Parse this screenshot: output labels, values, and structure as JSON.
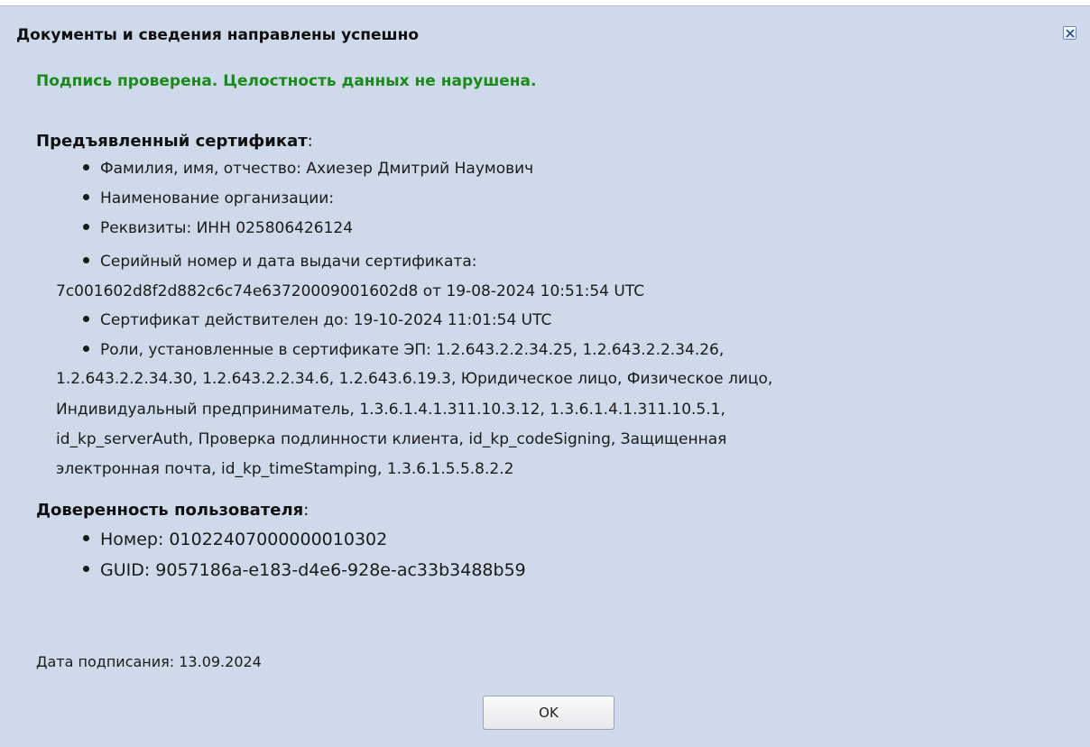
{
  "dialog": {
    "title": "Документы и сведения направлены успешно",
    "close_icon": "close-icon",
    "status": "Подпись проверена. Целостность данных не нарушена.",
    "status_color": "#1a8a1a",
    "background": "#cedae9"
  },
  "certificate": {
    "heading_bold": "Предъявленный сертификат",
    "heading_suffix": ":",
    "items": [
      "Фамилия, имя, отчество: Ахиезер Дмитрий Наумович",
      "Наименование организации:",
      "Реквизиты: ИНН 025806426124",
      "Серийный номер и дата выдачи сертификата:"
    ],
    "serial_line": "7c001602d8f2d882c6c74e63720009001602d8 от 19-08-2024 10:51:54 UTC",
    "valid_until": "Сертификат действителен до: 19-10-2024 11:01:54 UTC",
    "roles_lines": [
      "Роли, установленные в сертификате ЭП: 1.2.643.2.2.34.25, 1.2.643.2.2.34.26,",
      "1.2.643.2.2.34.30, 1.2.643.2.2.34.6, 1.2.643.6.19.3, Юридическое лицо, Физическое лицо,",
      "Индивидуальный предприниматель, 1.3.6.1.4.1.311.10.3.12, 1.3.6.1.4.1.311.10.5.1,",
      "id_kp_serverAuth, Проверка подлинности клиента, id_kp_codeSigning, Защищенная",
      "электронная почта, id_kp_timeStamping, 1.3.6.1.5.5.8.2.2"
    ]
  },
  "power_of_attorney": {
    "heading_bold": "Доверенность пользователя",
    "heading_suffix": ":",
    "number": "Номер: 01022407000000010302",
    "guid": "GUID: 9057186a-e183-d4e6-928e-ac33b3488b59"
  },
  "signing_date": "Дата подписания: 13.09.2024",
  "buttons": {
    "ok": "OK"
  }
}
